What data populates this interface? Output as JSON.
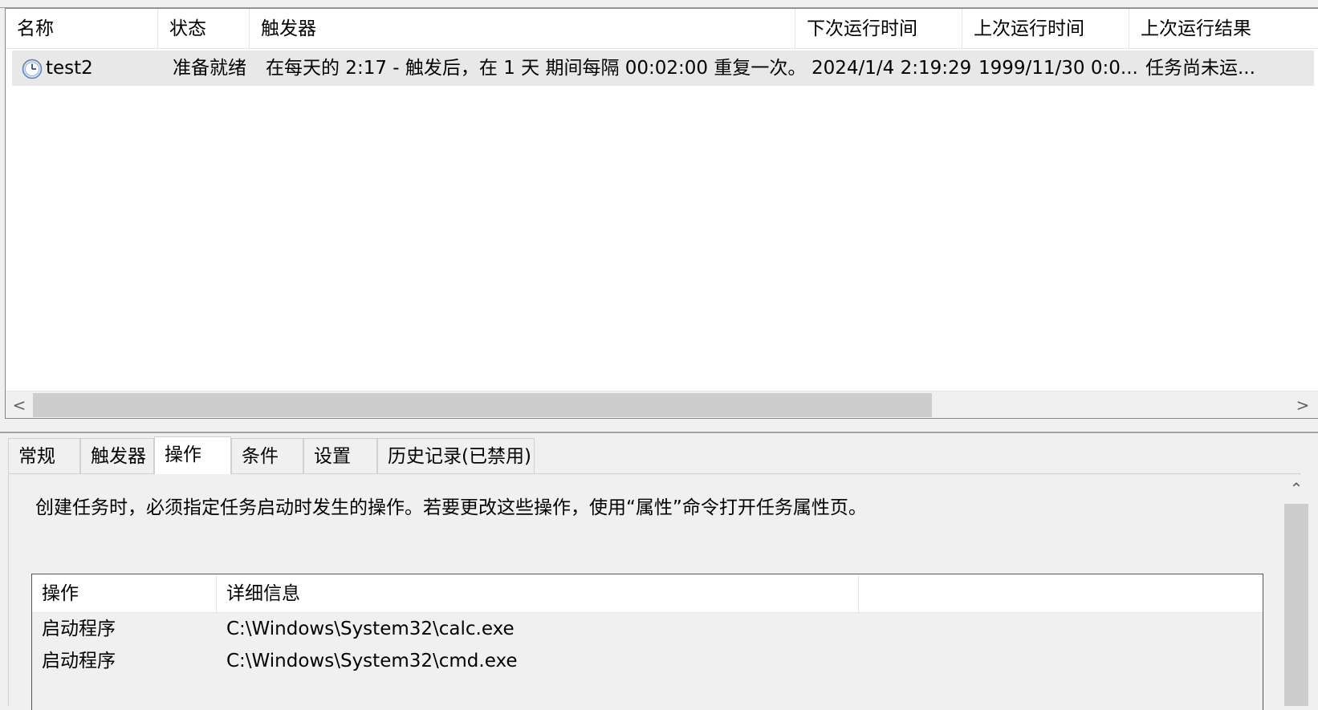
{
  "task_list": {
    "columns": [
      "名称",
      "状态",
      "触发器",
      "下次运行时间",
      "上次运行时间",
      "上次运行结果"
    ],
    "rows": [
      {
        "icon": "clock-icon",
        "name": "test2",
        "status": "准备就绪",
        "trigger": "在每天的 2:17 - 触发后，在 1 天 期间每隔 00:02:00 重复一次。",
        "next_run": "2024/1/4 2:19:29",
        "last_run": "1999/11/30 0:0...",
        "last_result": "任务尚未运..."
      }
    ]
  },
  "scrollbar": {
    "left_arrow": "<",
    "right_arrow": ">",
    "up_arrow": "⌃"
  },
  "tabs": [
    {
      "label": "常规",
      "active": false
    },
    {
      "label": "触发器",
      "active": false
    },
    {
      "label": "操作",
      "active": true
    },
    {
      "label": "条件",
      "active": false
    },
    {
      "label": "设置",
      "active": false
    },
    {
      "label": "历史记录(已禁用)",
      "active": false
    }
  ],
  "actions_tab": {
    "description": "创建任务时，必须指定任务启动时发生的操作。若要更改这些操作，使用“属性”命令打开任务属性页。",
    "columns": [
      "操作",
      "详细信息"
    ],
    "rows": [
      {
        "action": "启动程序",
        "details": "C:\\Windows\\System32\\calc.exe"
      },
      {
        "action": "启动程序",
        "details": "C:\\Windows\\System32\\cmd.exe"
      }
    ]
  },
  "colors": {
    "selected_row": "#e8e8e8",
    "window_bg": "#f0f0f0",
    "scroll_thumb": "#cdcdcd"
  }
}
